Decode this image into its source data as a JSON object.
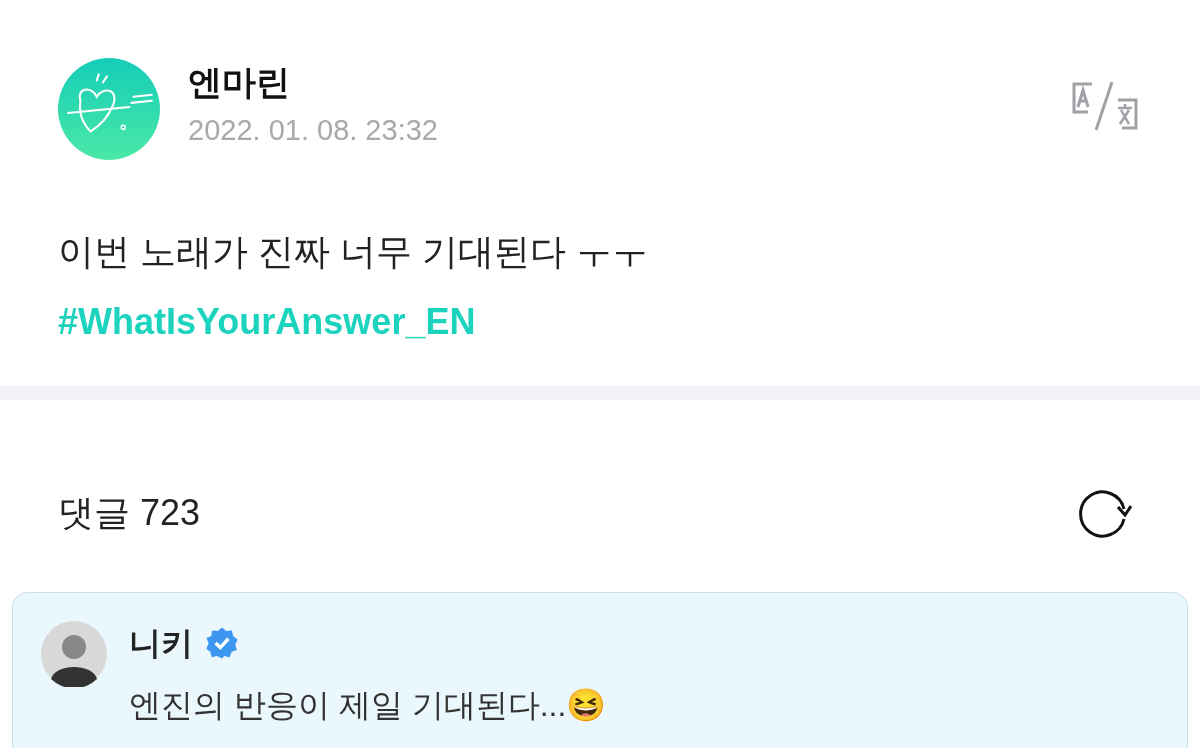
{
  "post": {
    "author": "엔마린",
    "timestamp": "2022. 01. 08. 23:32",
    "text": "이번 노래가 진짜 너무 기대된다 ㅜㅜ",
    "hashtag": "#WhatIsYourAnswer_EN"
  },
  "comments_header": {
    "label": "댓글 723"
  },
  "comments": [
    {
      "author": "니키",
      "verified": true,
      "highlighted": true,
      "text": "엔진의 반응이 제일 기대된다...😆"
    }
  ]
}
